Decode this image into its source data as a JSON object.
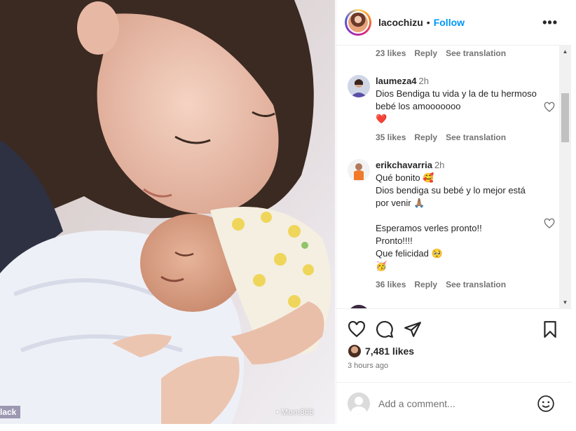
{
  "photo": {
    "watermark_left": "lack",
    "watermark_right": "• Mom365"
  },
  "header": {
    "username": "lacochizu",
    "separator": "•",
    "follow_label": "Follow",
    "more_icon": "•••"
  },
  "comments": {
    "top_meta": {
      "likes": "23 likes",
      "reply": "Reply",
      "translate": "See translation"
    },
    "items": [
      {
        "user": "laumeza4",
        "time": "2h",
        "text": "Dios Bendiga tu vida y la de tu hermoso bebé los amooooooo\n❤️",
        "likes": "35 likes",
        "reply": "Reply",
        "translate": "See translation"
      },
      {
        "user": "erikchavarria",
        "time": "2h",
        "text": "Qué bonito 🥰\nDios bendiga su bebé y lo mejor está por venir 🙏🏽\n\nEsperamos verles pronto!!\nPronto!!!!\nQue felicidad 🥺\n🥳",
        "likes": "36 likes",
        "reply": "Reply",
        "translate": "See translation"
      }
    ]
  },
  "scrollbar": {
    "up": "▲",
    "down": "▼"
  },
  "actions": {
    "likes_count": "7,481 likes",
    "time_ago": "3 hours ago",
    "icons": [
      "heart-icon",
      "comment-icon",
      "share-icon",
      "bookmark-icon"
    ]
  },
  "add_comment": {
    "placeholder": "Add a comment..."
  },
  "colors": {
    "link": "#0095f6",
    "muted": "#737373",
    "text": "#262626",
    "heart_red": "#ed4956"
  }
}
